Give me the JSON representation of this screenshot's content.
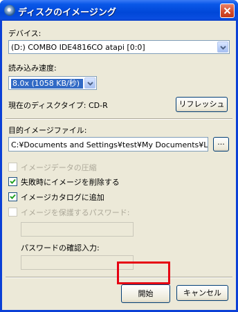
{
  "window": {
    "title": "ディスクのイメージング"
  },
  "device": {
    "label": "デバイス:",
    "selected": "(D:) COMBO IDE4816CO atapi [0:0]"
  },
  "speed": {
    "label": "読み込み速度:",
    "selected": "8.0x (1058 KB/秒)"
  },
  "disc_type": {
    "text": "現在のディスクタイプ: CD-R",
    "refresh_label": "リフレッシュ"
  },
  "target": {
    "label": "目的イメージファイル:",
    "value": "C:¥Documents and Settings¥test¥My Documents¥LOGICAL",
    "browse_label": "..."
  },
  "options": [
    {
      "label": "イメージデータの圧縮",
      "checked": false,
      "enabled": false
    },
    {
      "label": "失敗時にイメージを削除する",
      "checked": true,
      "enabled": true
    },
    {
      "label": "イメージカタログに追加",
      "checked": true,
      "enabled": true
    },
    {
      "label": "イメージを保護するパスワード:",
      "checked": false,
      "enabled": false
    }
  ],
  "password": {
    "confirm_label": "パスワードの確認入力:"
  },
  "footer": {
    "start_label": "開始",
    "cancel_label": "キャンセル"
  },
  "colors": {
    "titlebar": "#0a58e8",
    "dialog_bg": "#ece9d8",
    "highlight_border": "#e60012",
    "selection": "#316ac5"
  }
}
